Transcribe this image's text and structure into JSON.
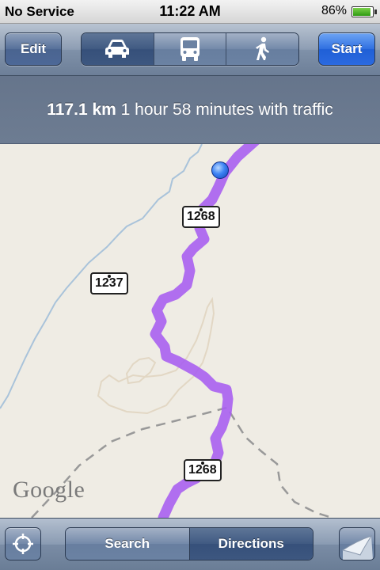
{
  "status_bar": {
    "carrier": "No Service",
    "time": "11:22 AM",
    "battery_percent": "86%",
    "battery_level": 0.86
  },
  "toolbar": {
    "edit_label": "Edit",
    "start_label": "Start",
    "modes": [
      {
        "icon": "car-icon",
        "active": true
      },
      {
        "icon": "bus-icon",
        "active": false
      },
      {
        "icon": "walking-icon",
        "active": false
      }
    ]
  },
  "route_summary": {
    "distance": "117.1 km",
    "duration": "1 hour 58 minutes with traffic"
  },
  "map": {
    "route_color": "#a860f0",
    "shields": [
      "1268",
      "1237",
      "1268"
    ],
    "attribution": "Google"
  },
  "bottom_bar": {
    "locate_icon": "current-location-icon",
    "search_label": "Search",
    "directions_label": "Directions",
    "active_tab": "Directions",
    "page_curl_icon": "page-curl-icon"
  }
}
